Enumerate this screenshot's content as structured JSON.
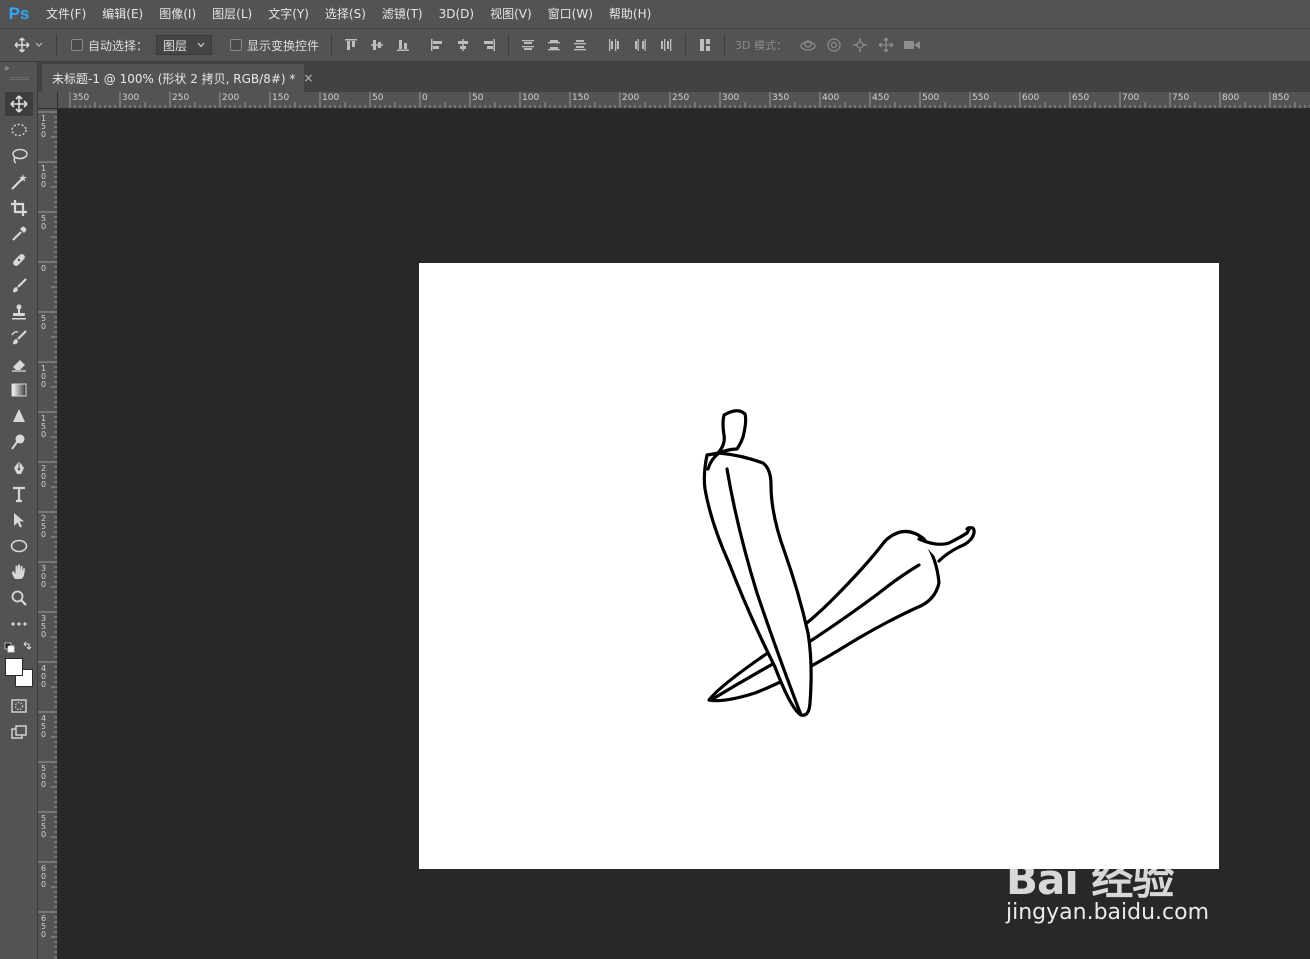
{
  "app": {
    "logo": "Ps"
  },
  "menu": [
    "文件(F)",
    "编辑(E)",
    "图像(I)",
    "图层(L)",
    "文字(Y)",
    "选择(S)",
    "滤镜(T)",
    "3D(D)",
    "视图(V)",
    "窗口(W)",
    "帮助(H)"
  ],
  "options": {
    "auto_select_label": "自动选择：",
    "auto_select_target": "图层",
    "show_transform_label": "显示变换控件",
    "mode_3d_label": "3D 模式："
  },
  "document": {
    "tab_title": "未标题-1 @ 100% (形状 2 拷贝, RGB/8#) *",
    "close_glyph": "×"
  },
  "ruler": {
    "h_labels": [
      "350",
      "300",
      "250",
      "200",
      "150",
      "100",
      "50",
      "0",
      "50",
      "100",
      "150",
      "200",
      "250",
      "300",
      "350",
      "400",
      "450",
      "500",
      "550",
      "600",
      "650",
      "700",
      "750",
      "800",
      "850"
    ],
    "v_labels": [
      "150",
      "100",
      "50",
      "0",
      "50",
      "100",
      "150",
      "200",
      "250",
      "300",
      "350",
      "400",
      "450",
      "500",
      "550",
      "600",
      "650"
    ]
  },
  "tools": [
    "move-icon",
    "marquee-icon",
    "lasso-icon",
    "magic-wand-icon",
    "crop-icon",
    "eyedropper-icon",
    "healing-icon",
    "brush-icon",
    "stamp-icon",
    "history-brush-icon",
    "eraser-icon",
    "gradient-icon",
    "blur-icon",
    "dodge-icon",
    "pen-icon",
    "type-icon",
    "path-select-icon",
    "ellipse-icon",
    "hand-icon",
    "zoom-icon",
    "more-icon"
  ],
  "colors": {
    "foreground": "#ffffff",
    "background": "#ffffff",
    "canvas": "#ffffff",
    "pasteboard": "#282828"
  },
  "watermark": {
    "logo": "Bai 经验",
    "url": "jingyan.baidu.com"
  }
}
